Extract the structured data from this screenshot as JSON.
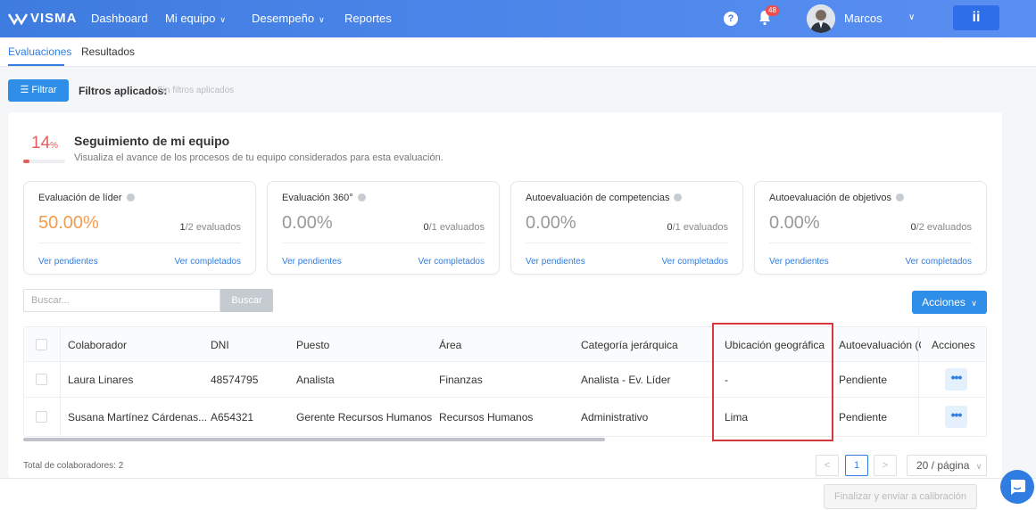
{
  "app": {
    "logo": "VISMA"
  },
  "nav": {
    "items": [
      {
        "label": "Dashboard"
      },
      {
        "label": "Mi equipo"
      },
      {
        "label": "Desempeño"
      },
      {
        "label": "Reportes"
      }
    ],
    "help_glyph": "?",
    "notification_count": "48",
    "user_name": "Marcos",
    "apps_glyph": "ii"
  },
  "tabs": [
    {
      "label": "Evaluaciones",
      "active": true
    },
    {
      "label": "Resultados",
      "active": false
    }
  ],
  "filters": {
    "button_label": "Filtrar",
    "applied_label": "Filtros aplicados:",
    "applied_value": "Sin filtros aplicados"
  },
  "team": {
    "percent": "14",
    "percent_sign": "%",
    "progress_fraction": 0.14,
    "title": "Seguimiento de mi equipo",
    "subtitle": "Visualiza el avance de los procesos de tu equipo considerados para esta evaluación."
  },
  "stats": [
    {
      "title": "Evaluación de líder",
      "percent": "50.00%",
      "count_done": "1",
      "count_total": "/2 evaluados",
      "link_pending": "Ver pendientes",
      "link_done": "Ver completados",
      "accent": "#f39c4d"
    },
    {
      "title": "Evaluación 360°",
      "percent": "0.00%",
      "count_done": "0",
      "count_total": "/1 evaluados",
      "link_pending": "Ver pendientes",
      "link_done": "Ver completados"
    },
    {
      "title": "Autoevaluación de competencias",
      "percent": "0.00%",
      "count_done": "0",
      "count_total": "/1 evaluados",
      "link_pending": "Ver pendientes",
      "link_done": "Ver completados"
    },
    {
      "title": "Autoevaluación de objetivos",
      "percent": "0.00%",
      "count_done": "0",
      "count_total": "/2 evaluados",
      "link_pending": "Ver pendientes",
      "link_done": "Ver completados"
    }
  ],
  "search": {
    "placeholder": "Buscar...",
    "button_label": "Buscar"
  },
  "actions_button": "Acciones",
  "table": {
    "headers": [
      "Colaborador",
      "DNI",
      "Puesto",
      "Área",
      "Categoría jerárquica",
      "Ubicación geográfica",
      "Autoevaluación (C",
      "Acciones"
    ],
    "rows": [
      [
        "Laura Linares",
        "48574795",
        "Analista",
        "Finanzas",
        "Analista - Ev. Líder",
        "-",
        "Pendiente"
      ],
      [
        "Susana Martínez Cárdenas...",
        "A654321",
        "Gerente Recursos Humanos",
        "Recursos Humanos",
        "Administrativo",
        "Lima",
        "Pendiente"
      ]
    ],
    "row_action_glyph": "•••"
  },
  "footer": {
    "total": "Total de colaboradores: 2",
    "page_prev": "<",
    "page_current": "1",
    "page_next": ">",
    "page_size": "20 / página",
    "finish_button": "Finalizar y enviar a calibración"
  },
  "colors": {
    "brand_blue": "#3f7ce0",
    "link_blue": "#2f7de0",
    "accent_red": "#e0605a",
    "highlight": "#d9363e"
  }
}
